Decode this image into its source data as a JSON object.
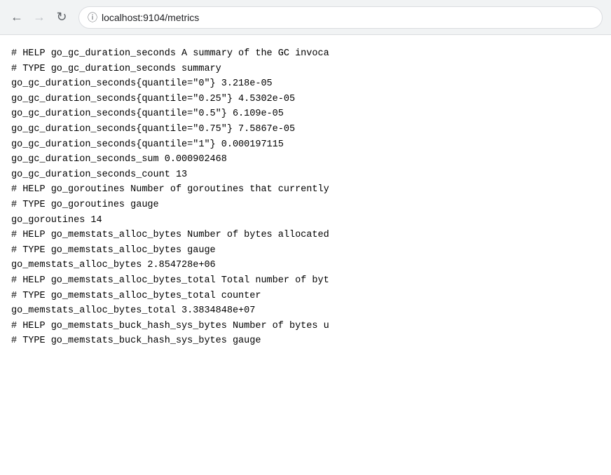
{
  "browser": {
    "url": "localhost:9104/metrics",
    "back_btn": "←",
    "forward_btn": "→",
    "refresh_btn": "↻"
  },
  "metrics": {
    "lines": [
      "# HELP go_gc_duration_seconds A summary of the GC invoca",
      "# TYPE go_gc_duration_seconds summary",
      "go_gc_duration_seconds{quantile=\"0\"} 3.218e-05",
      "go_gc_duration_seconds{quantile=\"0.25\"} 4.5302e-05",
      "go_gc_duration_seconds{quantile=\"0.5\"} 6.109e-05",
      "go_gc_duration_seconds{quantile=\"0.75\"} 7.5867e-05",
      "go_gc_duration_seconds{quantile=\"1\"} 0.000197115",
      "go_gc_duration_seconds_sum 0.000902468",
      "go_gc_duration_seconds_count 13",
      "# HELP go_goroutines Number of goroutines that currently",
      "# TYPE go_goroutines gauge",
      "go_goroutines 14",
      "# HELP go_memstats_alloc_bytes Number of bytes allocated",
      "# TYPE go_memstats_alloc_bytes gauge",
      "go_memstats_alloc_bytes 2.854728e+06",
      "# HELP go_memstats_alloc_bytes_total Total number of byt",
      "# TYPE go_memstats_alloc_bytes_total counter",
      "go_memstats_alloc_bytes_total 3.3834848e+07",
      "# HELP go_memstats_buck_hash_sys_bytes Number of bytes u",
      "# TYPE go_memstats_buck_hash_sys_bytes gauge"
    ]
  }
}
